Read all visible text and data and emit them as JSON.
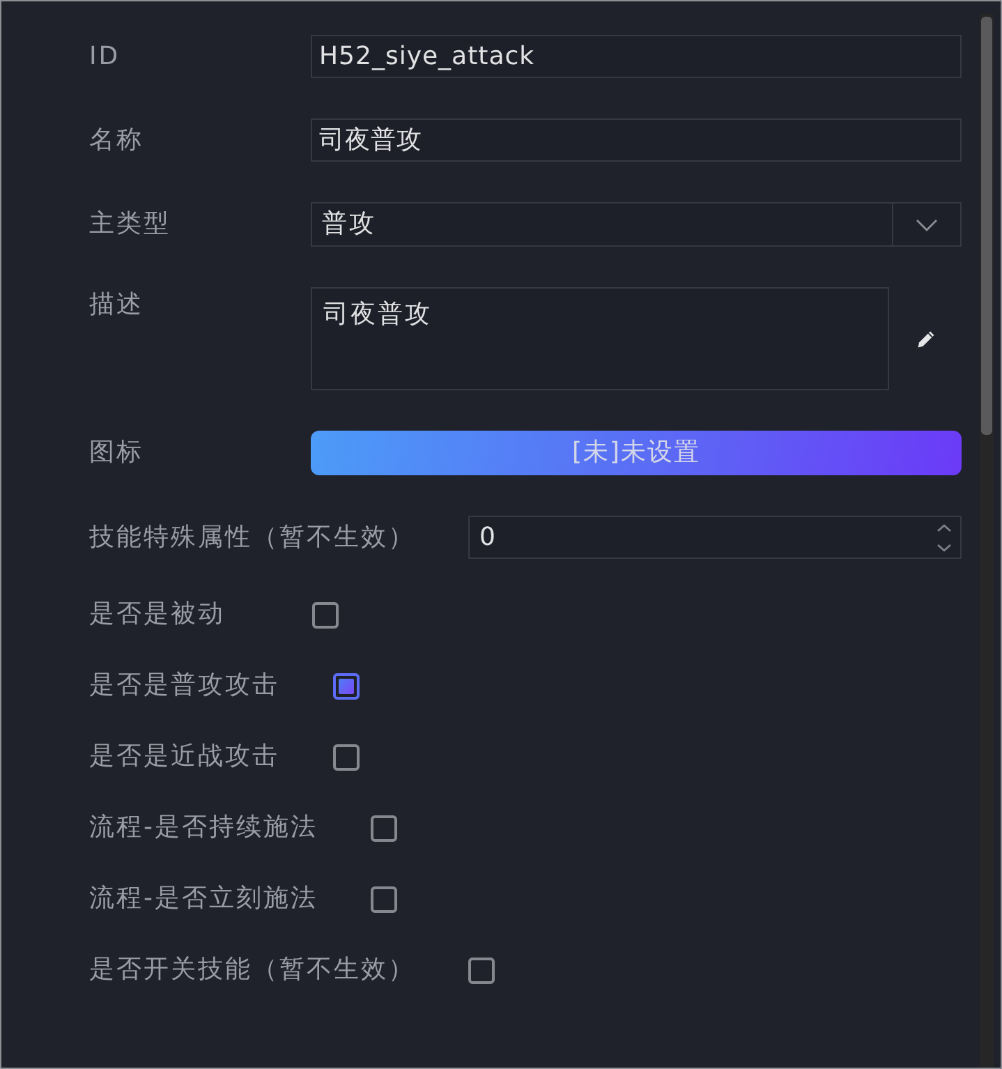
{
  "fields": [
    {
      "kind": "text",
      "label": "ID",
      "value": "H52_siye_attack"
    },
    {
      "kind": "text",
      "label": "名称",
      "value": "司夜普攻"
    },
    {
      "kind": "select",
      "label": "主类型",
      "value": "普攻"
    },
    {
      "kind": "textarea",
      "label": "描述",
      "value": "司夜普攻"
    },
    {
      "kind": "button",
      "label": "图标",
      "button_text": "[未]未设置"
    },
    {
      "kind": "number",
      "label": "技能特殊属性（暂不生效）",
      "value": "0"
    },
    {
      "kind": "checkbox",
      "label": "是否是被动",
      "checked": false
    },
    {
      "kind": "checkbox",
      "label": "是否是普攻攻击",
      "checked": true
    },
    {
      "kind": "checkbox",
      "label": "是否是近战攻击",
      "checked": false
    },
    {
      "kind": "checkbox",
      "label": "流程-是否持续施法",
      "checked": false
    },
    {
      "kind": "checkbox",
      "label": "流程-是否立刻施法",
      "checked": false
    },
    {
      "kind": "checkbox",
      "label": "是否开关技能（暂不生效）",
      "checked": false
    }
  ]
}
